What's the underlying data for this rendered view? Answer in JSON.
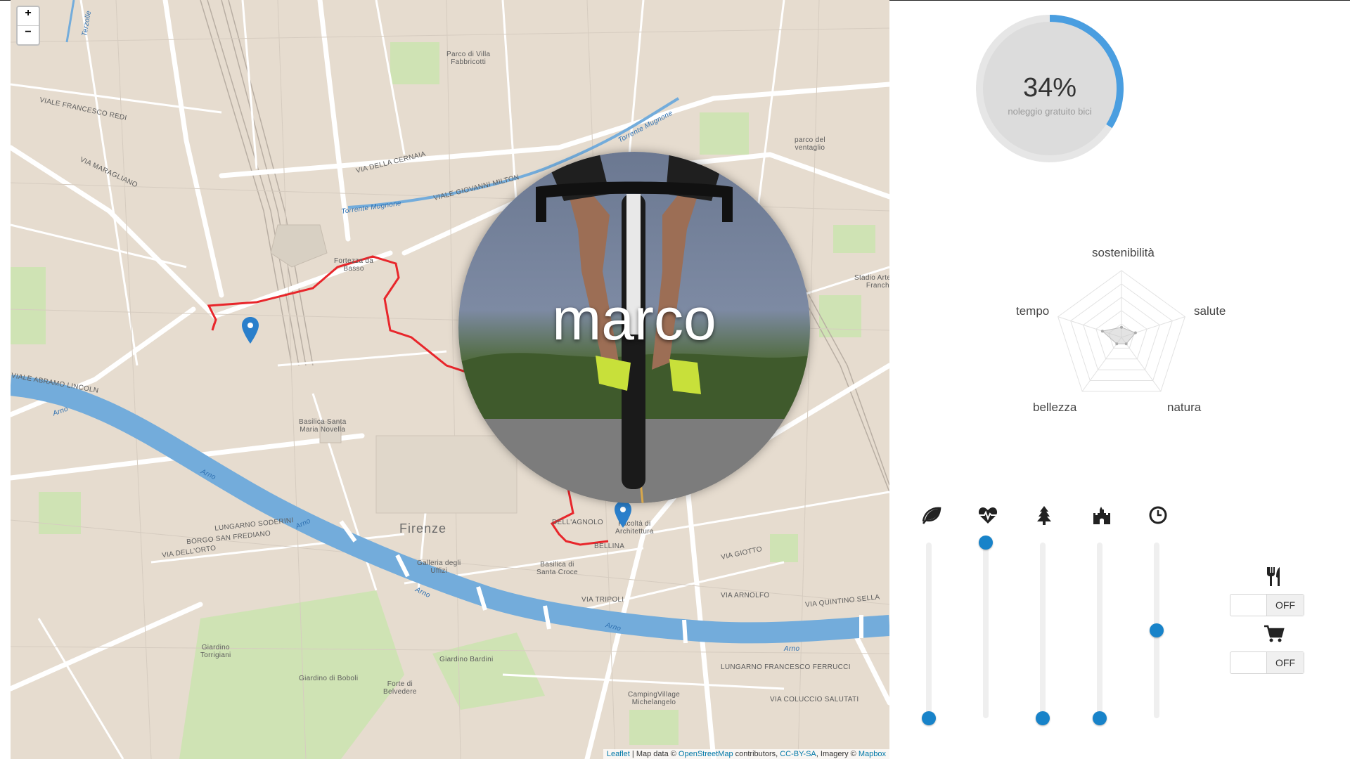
{
  "map": {
    "zoom_in": "+",
    "zoom_out": "−",
    "labels": {
      "firenze": "Firenze",
      "fortezza1": "Fortezza da",
      "fortezza2": "Basso",
      "parco_villa1": "Parco di Villa",
      "parco_villa2": "Fabbricotti",
      "parco_ventaglio1": "parco del",
      "parco_ventaglio2": "ventaglio",
      "santa_maria1": "Basilica Santa",
      "santa_maria2": "Maria Novella",
      "uffizi1": "Galleria degli",
      "uffizi2": "Uffizi",
      "santa_croce1": "Basilica di",
      "santa_croce2": "Santa Croce",
      "architettura1": "Facoltà di",
      "architettura2": "Architettura",
      "boboli": "Giardino di Boboli",
      "bardini": "Giardino Bardini",
      "torrigiani1": "Giardino",
      "torrigiani2": "Torrigiani",
      "belvedere1": "Forte di",
      "belvedere2": "Belvedere",
      "camping1": "CampingVillage",
      "camping2": "Michelangelo",
      "stadio1": "Stadio Artemio",
      "stadio2": "Franchi",
      "arno1": "Arno",
      "arno2": "Arno",
      "arno3": "Arno",
      "arno4": "Arno",
      "arno5": "Arno",
      "arno6": "Arno",
      "mugnone1": "Torrente Mugnone",
      "mugnone2": "Torrente Mugnone",
      "terzolle": "Terzolle",
      "via_ferrucci": "LUNGARNO FRANCESCO FERRUCCI",
      "via_soderini": "LUNGARNO SODERINI",
      "via_redi": "VIALE FRANCESCO REDI",
      "via_lincoln": "VIALE ABRAMO LINCOLN",
      "via_milton": "VIALE GIOVANNI MILTON",
      "via_colucci": "VIA COLUCCIO SALUTATI",
      "via_tripoli": "VIA TRIPOLI",
      "via_giotto": "VIA GIOTTO",
      "via_arnolfo": "VIA ARNOLFO",
      "via_sansone": "VIA QUINTINO SELLA",
      "via_frediano": "BORGO SAN FREDIANO",
      "via_orto": "VIA DELL'ORTO",
      "via_bellina": "BELLINA",
      "via_agnolo": "DELL'AGNOLO",
      "via_cernaia": "VIA DELLA CERNAIA",
      "via_maragliano": "VIA MARAGLIANO"
    },
    "attribution": {
      "leaflet": "Leaflet",
      "sep1": " | Map data © ",
      "osm": "OpenStreetMap",
      "sep2": " contributors, ",
      "ccbysa": "CC-BY-SA",
      "sep3": ", Imagery © ",
      "mapbox": "Mapbox"
    }
  },
  "profile": {
    "name": "marco"
  },
  "gauge": {
    "percent_text": "34%",
    "caption": "noleggio gratuito bici",
    "value": 0.34,
    "accent": "#4a9ee0"
  },
  "radar": {
    "axes": [
      "sostenibilità",
      "salute",
      "natura",
      "bellezza",
      "tempo"
    ],
    "values": [
      0.15,
      0.22,
      0.12,
      0.12,
      0.3
    ]
  },
  "sliders": [
    {
      "icon": "leaf-icon",
      "level": 0.0
    },
    {
      "icon": "heartbeat-icon",
      "level": 1.0
    },
    {
      "icon": "tree-icon",
      "level": 0.0
    },
    {
      "icon": "castle-icon",
      "level": 0.0
    },
    {
      "icon": "clock-icon",
      "level": 0.5
    }
  ],
  "toggles": [
    {
      "icon": "restaurant-icon",
      "state": "OFF"
    },
    {
      "icon": "cart-icon",
      "state": "OFF"
    }
  ],
  "colors": {
    "route": "#e8262b",
    "marker": "#2a7fcb",
    "river": "#73acdb",
    "slider": "#1883c9"
  }
}
